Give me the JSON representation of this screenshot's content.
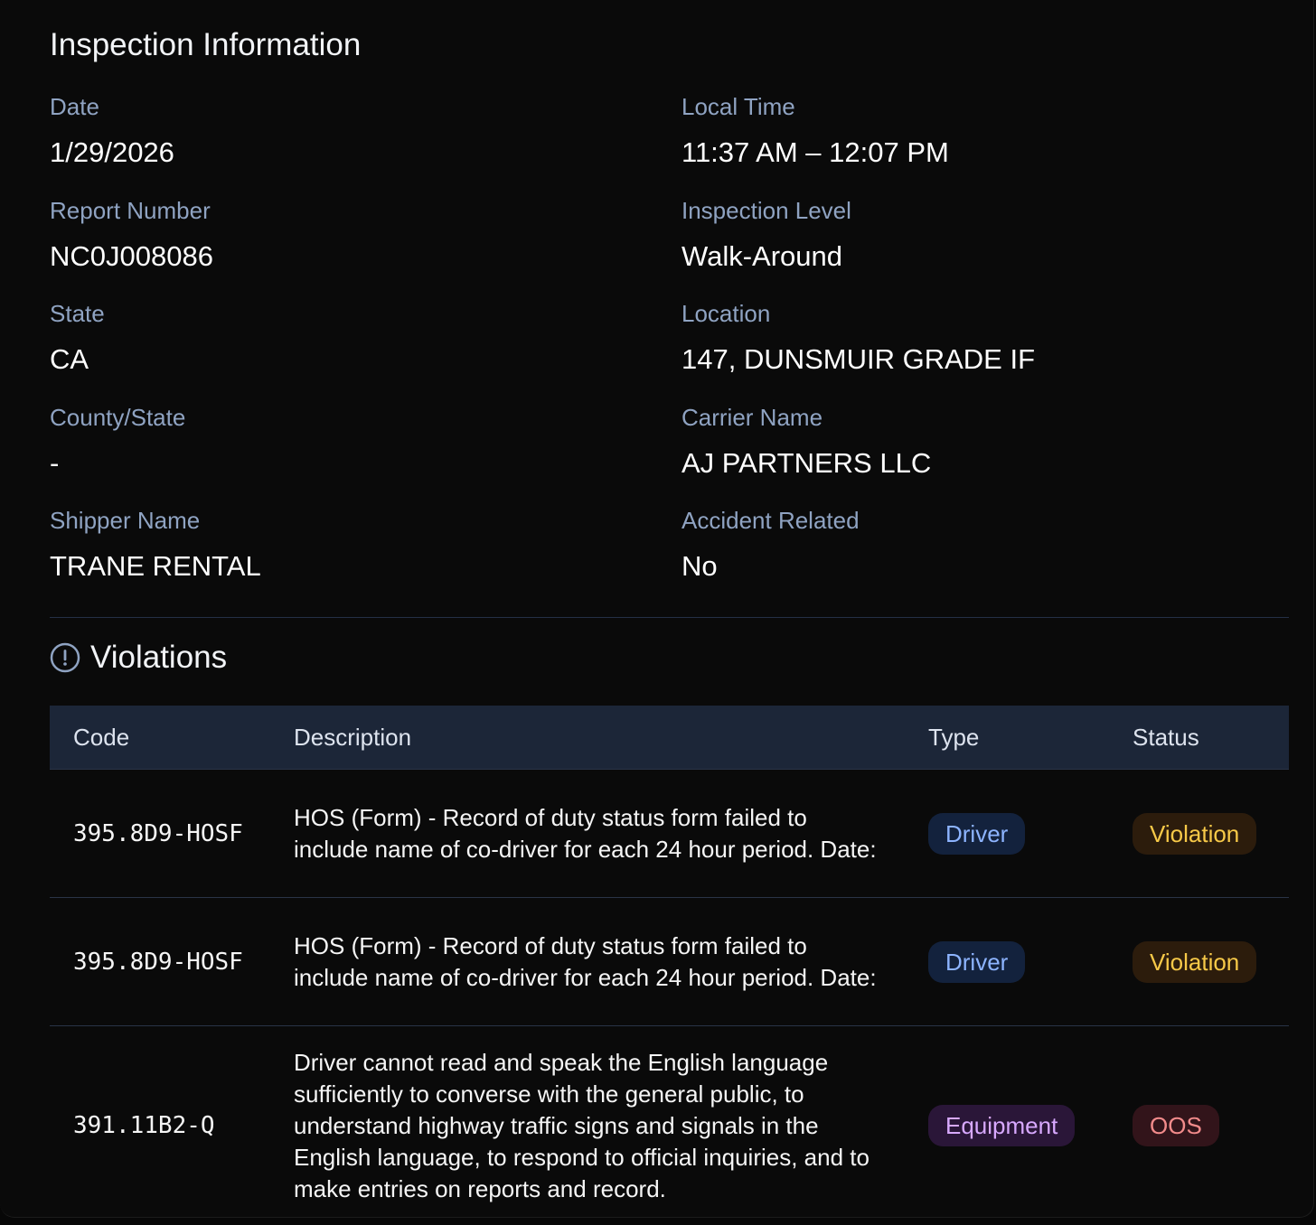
{
  "inspection": {
    "title": "Inspection Information",
    "fields": {
      "date": {
        "label": "Date",
        "value": "1/29/2026"
      },
      "local_time": {
        "label": "Local Time",
        "value": "11:37 AM – 12:07 PM"
      },
      "report_number": {
        "label": "Report Number",
        "value": "NC0J008086"
      },
      "inspection_level": {
        "label": "Inspection Level",
        "value": "Walk-Around"
      },
      "state": {
        "label": "State",
        "value": "CA"
      },
      "location": {
        "label": "Location",
        "value": "147, DUNSMUIR GRADE IF"
      },
      "county_state": {
        "label": "County/State",
        "value": "-"
      },
      "carrier_name": {
        "label": "Carrier Name",
        "value": "AJ PARTNERS LLC"
      },
      "shipper_name": {
        "label": "Shipper Name",
        "value": "TRANE RENTAL"
      },
      "accident_related": {
        "label": "Accident Related",
        "value": "No"
      }
    }
  },
  "violations": {
    "title": "Violations",
    "icon": "alert-circle-icon",
    "columns": [
      "Code",
      "Description",
      "Type",
      "Status"
    ],
    "rows": [
      {
        "code": "395.8D9-HOSF",
        "description": "HOS (Form) - Record of duty status form failed to include name of co-driver for each 24 hour period. Date:",
        "type": "Driver",
        "status": "Violation"
      },
      {
        "code": "395.8D9-HOSF",
        "description": "HOS (Form) - Record of duty status form failed to include name of co-driver for each 24 hour period. Date:",
        "type": "Driver",
        "status": "Violation"
      },
      {
        "code": "391.11B2-Q",
        "description": "Driver cannot read and speak the English language sufficiently to converse with the general public, to understand highway traffic signs and signals in the English language, to respond to official inquiries, and to make entries on reports and record.",
        "type": "Equipment",
        "status": "OOS"
      }
    ]
  },
  "colors": {
    "background": "#0a0a0a",
    "label": "#8fa3c2",
    "table_header": "#1c2638",
    "driver_badge_bg": "#13223d",
    "driver_badge_fg": "#8db4ff",
    "equipment_badge_bg": "#2a1638",
    "equipment_badge_fg": "#d8a9ff",
    "violation_badge_bg": "#2c1c0c",
    "violation_badge_fg": "#f7c948",
    "oos_badge_bg": "#32141a",
    "oos_badge_fg": "#f28b8b"
  }
}
